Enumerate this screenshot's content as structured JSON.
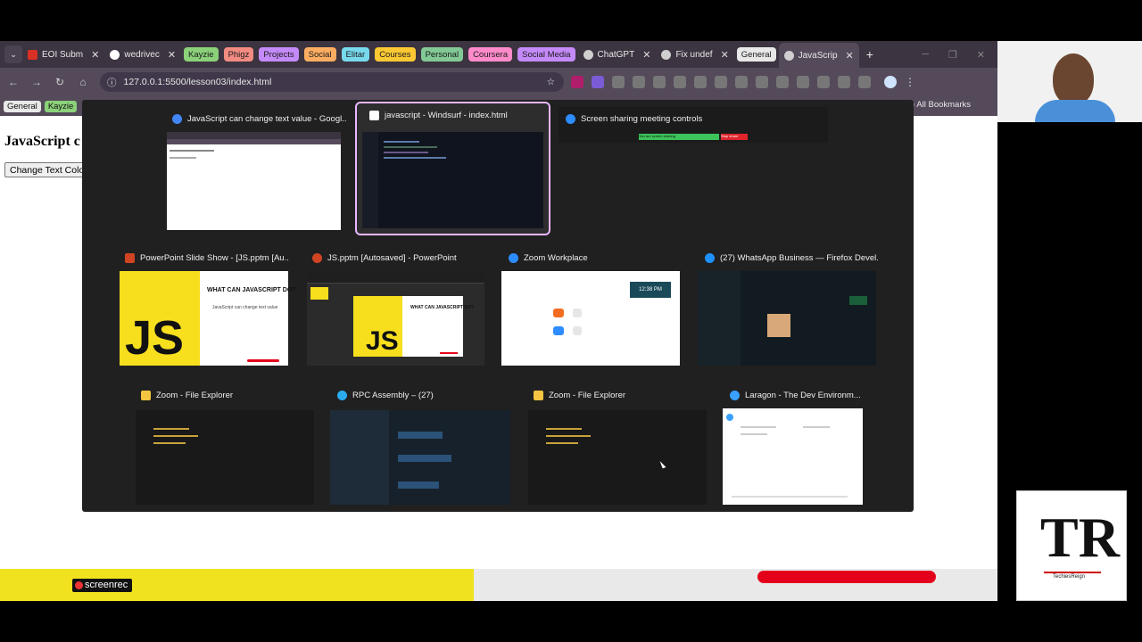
{
  "tabs": [
    {
      "title": "EOI Subm",
      "color": "#d93025"
    },
    {
      "title": "wedrivec",
      "color": "#ffffff"
    }
  ],
  "groups": [
    {
      "label": "Kayzie",
      "color": "#8bd17a"
    },
    {
      "label": "Phigz",
      "color": "#f28b82"
    },
    {
      "label": "Projects",
      "color": "#c58af9"
    },
    {
      "label": "Social",
      "color": "#fdad62"
    },
    {
      "label": "Elitar",
      "color": "#78d9ec"
    },
    {
      "label": "Courses",
      "color": "#fcc934"
    },
    {
      "label": "Personal",
      "color": "#81c995"
    },
    {
      "label": "Coursera",
      "color": "#ff8bcb"
    },
    {
      "label": "Social Media",
      "color": "#c58af9"
    }
  ],
  "tabs2": [
    {
      "title": "ChatGPT"
    },
    {
      "title": "Fix undef"
    }
  ],
  "general_group": "General",
  "active_tab": "JavaScrip",
  "address": "127.0.0.1:5500/lesson03/index.html",
  "bookmarks": [
    {
      "label": "General",
      "color": "#e8e8e8"
    },
    {
      "label": "Kayzie",
      "color": "#8bd17a"
    }
  ],
  "all_bookmarks": "All Bookmarks",
  "page": {
    "heading": "JavaScript c",
    "button": "Change Text Color"
  },
  "windows": [
    {
      "title": "JavaScript can change text value - Googl...",
      "icon_color": "#4285f4"
    },
    {
      "title": "javascript - Windsurf - index.html",
      "icon_color": "#ffffff"
    },
    {
      "title": "Screen sharing meeting controls",
      "icon_color": "#2d8cff"
    },
    {
      "title": "PowerPoint Slide Show - [JS.pptm [Au...",
      "icon_color": "#d04423"
    },
    {
      "title": "JS.pptm [Autosaved] - PowerPoint",
      "icon_color": "#d04423"
    },
    {
      "title": "Zoom Workplace",
      "icon_color": "#2d8cff"
    },
    {
      "title": "(27) WhatsApp Business — Firefox Devel...",
      "icon_color": "#1e90ff"
    },
    {
      "title": "Zoom - File Explorer",
      "icon_color": "#f5c542"
    },
    {
      "title": "RPC Assembly – (27)",
      "icon_color": "#2aabee"
    },
    {
      "title": "Zoom - File Explorer",
      "icon_color": "#f5c542"
    },
    {
      "title": "Laragon - The Dev Environm...",
      "icon_color": "#3aa0ff"
    }
  ],
  "slide": {
    "heading": "WHAT CAN JAVASCRIPT DO?",
    "body": "JavaScript can change text value",
    "logo": "JS"
  },
  "zoom_time": "12:38 PM",
  "screen_share": {
    "status": "You are screen sharing",
    "stop": "Stop share"
  },
  "screenrec": "screenrec",
  "logo": {
    "letters": "TR",
    "name": "TechiesReign"
  }
}
